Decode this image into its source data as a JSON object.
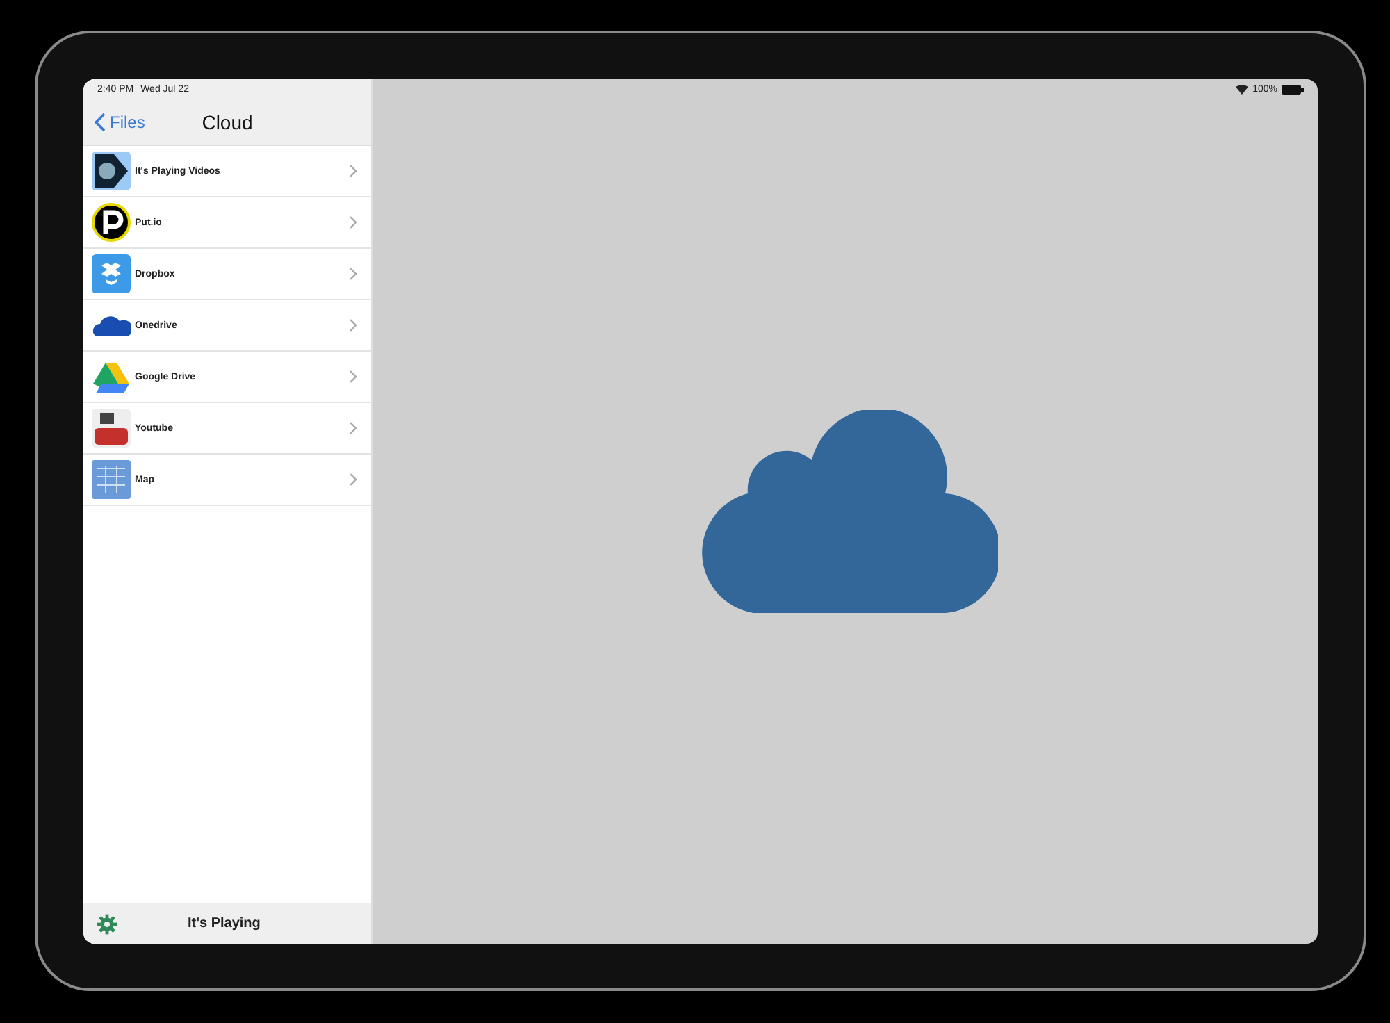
{
  "status_bar": {
    "time": "2:40 PM",
    "date": "Wed Jul 22",
    "battery": "100%"
  },
  "nav_bar": {
    "back": "Files",
    "title": "Cloud"
  },
  "items": [
    {
      "label": "It's Playing Videos",
      "kind": "player"
    },
    {
      "label": "Put.io",
      "kind": "putio"
    },
    {
      "label": "Dropbox",
      "kind": "dropbox"
    },
    {
      "label": "Onedrive",
      "kind": "onedrive"
    },
    {
      "label": "Google Drive",
      "kind": "gdrive"
    },
    {
      "label": "Youtube",
      "kind": "youtube"
    },
    {
      "label": "Map",
      "kind": "map"
    }
  ],
  "toolbar": {
    "title": "It's Playing"
  }
}
